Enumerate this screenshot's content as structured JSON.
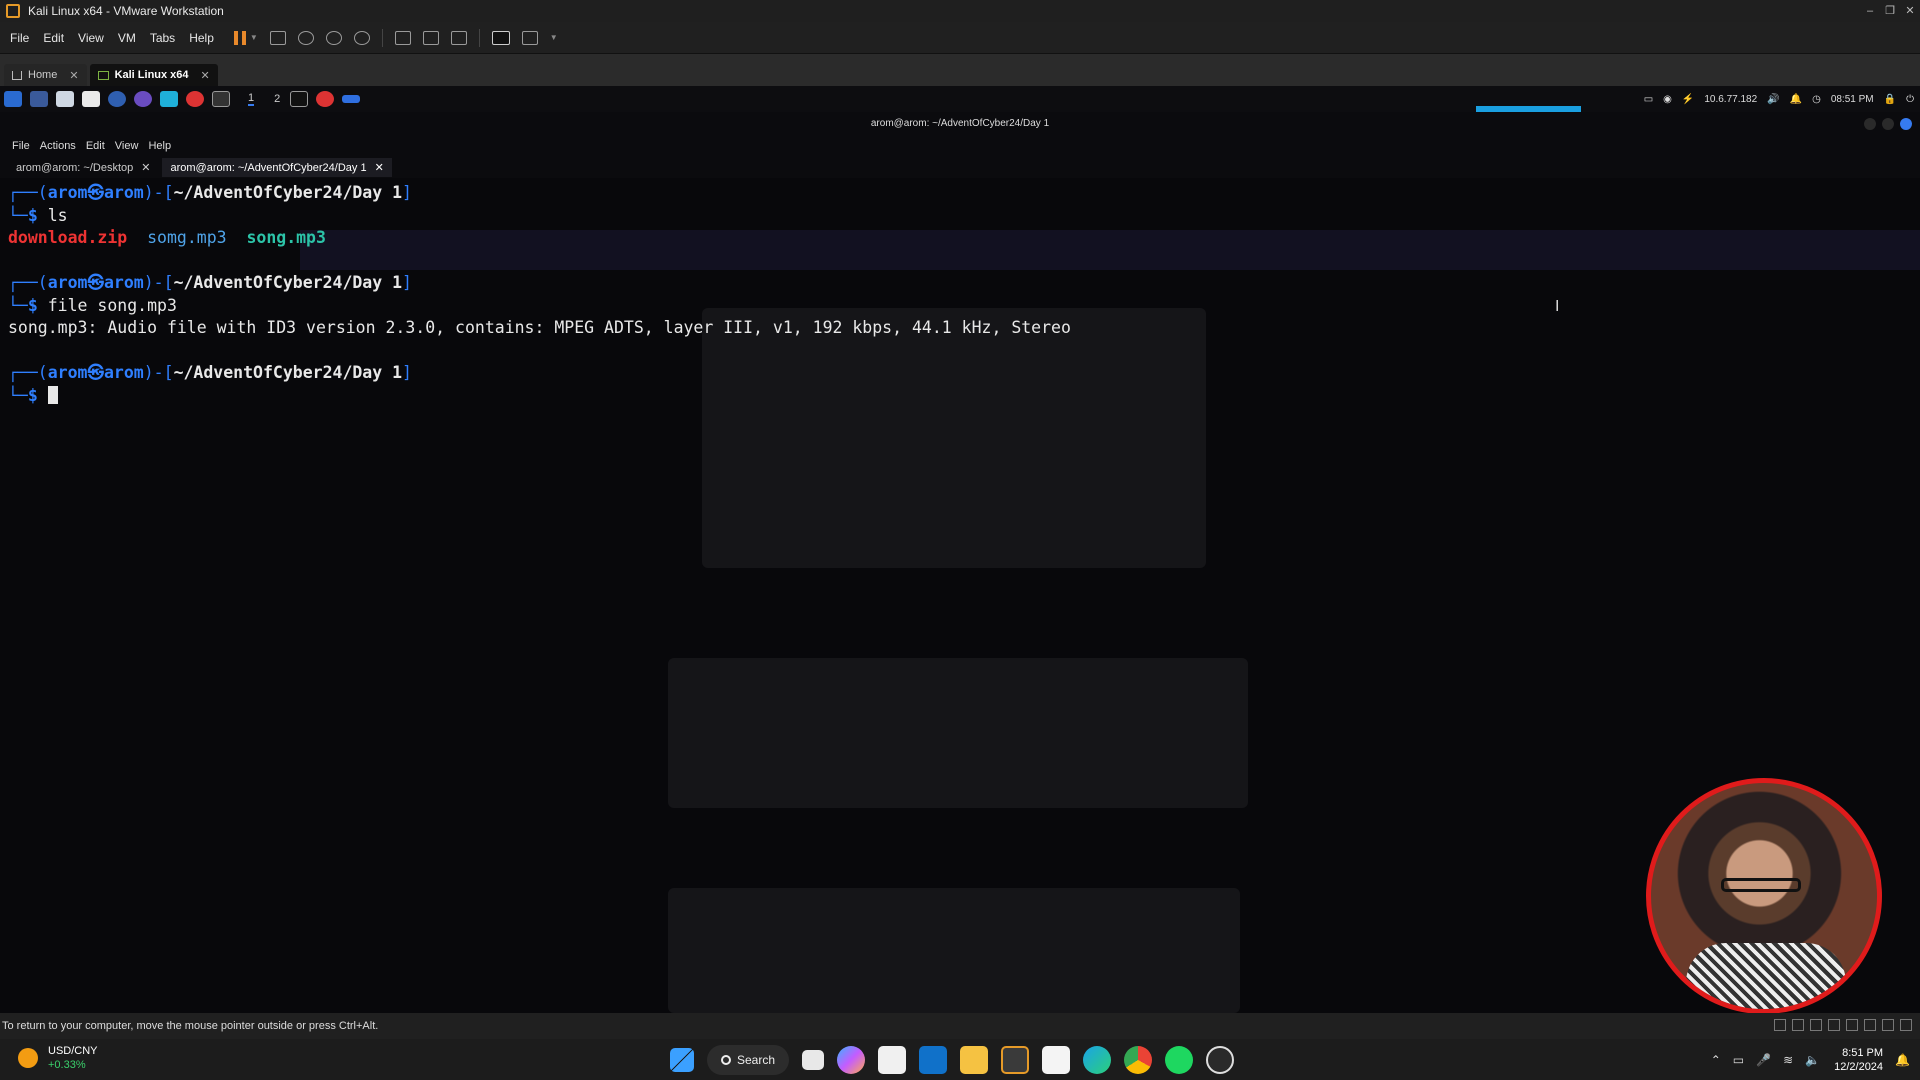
{
  "window": {
    "title": "Kali Linux x64 - VMware Workstation"
  },
  "vm_menu": [
    "File",
    "Edit",
    "View",
    "VM",
    "Tabs",
    "Help"
  ],
  "vm_tabs": [
    {
      "label": "Home"
    },
    {
      "label": "Kali Linux x64"
    }
  ],
  "kali_panel": {
    "workspaces": [
      "1",
      "2"
    ],
    "ip": "10.6.77.182",
    "time": "08:51 PM"
  },
  "terminal": {
    "title": "arom@arom: ~/AdventOfCyber24/Day 1",
    "menu": [
      "File",
      "Actions",
      "Edit",
      "View",
      "Help"
    ],
    "tabs": [
      {
        "label": "arom@arom: ~/Desktop"
      },
      {
        "label": "arom@arom: ~/AdventOfCyber24/Day 1"
      }
    ],
    "prompt": {
      "user": "arom",
      "at": "㉿",
      "host": "arom",
      "path": "~/AdventOfCyber24/Day 1"
    },
    "cmd1": "ls",
    "ls_output": [
      "download.zip",
      "somg.mp3",
      "song.mp3"
    ],
    "cmd2": "file song.mp3",
    "file_output": "song.mp3: Audio file with ID3 version 2.3.0, contains: MPEG ADTS, layer III, v1, 192 kbps, 44.1 kHz, Stereo"
  },
  "status_bar": {
    "message": "To return to your computer, move the mouse pointer outside or press Ctrl+Alt."
  },
  "taskbar": {
    "ticker_name": "USD/CNY",
    "ticker_change": "+0.33%",
    "search_label": "Search",
    "clock_time": "8:51 PM",
    "clock_date": "12/2/2024"
  }
}
